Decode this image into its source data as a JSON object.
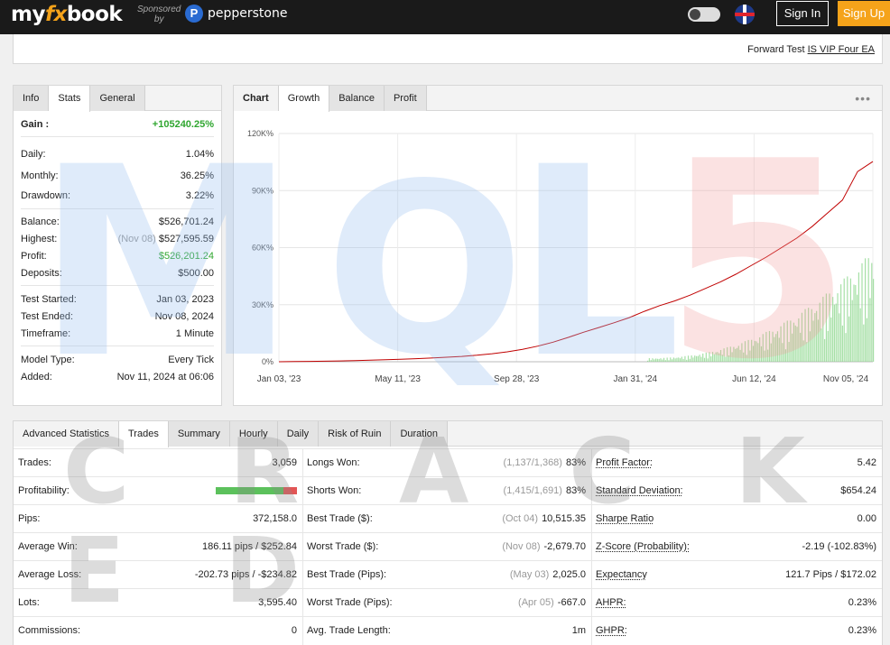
{
  "header": {
    "logo_my": "my",
    "logo_fx": "fx",
    "logo_book": "book",
    "sponsored_line1": "Sponsored",
    "sponsored_line2": "by",
    "sponsor_icon": "P",
    "sponsor_name": "pepperstone",
    "sign_in": "Sign In",
    "sign_up": "Sign Up",
    "accent": "#f5a31a"
  },
  "forward_test": {
    "prefix": "Forward Test",
    "link": "IS VIP Four EA"
  },
  "stats_panel": {
    "tabs": [
      "Info",
      "Stats",
      "General"
    ],
    "active_tab": "Stats",
    "gain_label": "Gain :",
    "gain_value": "+105240.25%",
    "daily_label": "Daily:",
    "daily_value": "1.04%",
    "monthly_label": "Monthly:",
    "monthly_value": "36.25%",
    "drawdown_label": "Drawdown:",
    "drawdown_value": "3.22%",
    "balance_label": "Balance:",
    "balance_value": "$526,701.24",
    "highest_label": "Highest:",
    "highest_date": "(Nov 08)",
    "highest_value": "$527,595.59",
    "profit_label": "Profit:",
    "profit_value": "$526,201.24",
    "deposits_label": "Deposits:",
    "deposits_value": "$500.00",
    "test_started_label": "Test Started:",
    "test_started_value": "Jan 03, 2023",
    "test_ended_label": "Test Ended:",
    "test_ended_value": "Nov 08, 2024",
    "timeframe_label": "Timeframe:",
    "timeframe_value": "1 Minute",
    "model_type_label": "Model Type:",
    "model_type_value": "Every Tick",
    "added_label": "Added:",
    "added_value": "Nov 11, 2024 at 06:06",
    "green": "#2fa62f"
  },
  "chart_panel": {
    "tabs": [
      "Chart",
      "Growth",
      "Balance",
      "Profit"
    ],
    "active_tab": "Growth",
    "menu_icon": "•••"
  },
  "chart_data": {
    "type": "line",
    "yticks": [
      "120K%",
      "90K%",
      "60K%",
      "30K%",
      "0%"
    ],
    "ytick_values": [
      120000,
      90000,
      60000,
      30000,
      0
    ],
    "xticks": [
      "Jan 03, '23",
      "May 11, '23",
      "Sep 28, '23",
      "Jan 31, '24",
      "Jun 12, '24",
      "Nov 05, '24"
    ],
    "ylim": [
      0,
      120000
    ],
    "grid": true,
    "line_color": "#c00000",
    "bar_color": "#90d890",
    "series": [
      {
        "values": [
          0,
          80,
          180,
          300,
          450,
          620,
          820,
          1050,
          1300,
          1600,
          1950,
          2350,
          2800,
          3400,
          4200,
          5200,
          6500,
          8200,
          10300,
          12800,
          15500,
          18000,
          20500,
          23200,
          26500,
          29500,
          32000,
          35000,
          38500,
          42000,
          46000,
          50500,
          55000,
          60000,
          65000,
          71000,
          78000,
          85000,
          100000,
          105240
        ]
      }
    ]
  },
  "advanced": {
    "tabs": [
      "Advanced Statistics",
      "Trades",
      "Summary",
      "Hourly",
      "Daily",
      "Risk of Ruin",
      "Duration"
    ],
    "active_tab": "Trades",
    "col1": [
      {
        "label": "Trades:",
        "value": "3,059"
      },
      {
        "label": "Profitability:",
        "value": ""
      },
      {
        "label": "Pips:",
        "value": "372,158.0"
      },
      {
        "label": "Average Win:",
        "value": "186.11 pips / $252.84"
      },
      {
        "label": "Average Loss:",
        "value": "-202.73 pips / -$234.82"
      },
      {
        "label": "Lots:",
        "value": "3,595.40"
      },
      {
        "label": "Commissions:",
        "value": "0"
      }
    ],
    "profitability_pct": 83,
    "col2": [
      {
        "label": "Longs Won:",
        "dim": "(1,137/1,368)",
        "value": "83%"
      },
      {
        "label": "Shorts Won:",
        "dim": "(1,415/1,691)",
        "value": "83%"
      },
      {
        "label": "Best Trade ($):",
        "dim": "(Oct 04)",
        "value": "10,515.35"
      },
      {
        "label": "Worst Trade ($):",
        "dim": "(Nov 08)",
        "value": "-2,679.70"
      },
      {
        "label": "Best Trade (Pips):",
        "dim": "(May 03)",
        "value": "2,025.0"
      },
      {
        "label": "Worst Trade (Pips):",
        "dim": "(Apr 05)",
        "value": "-667.0"
      },
      {
        "label": "Avg. Trade Length:",
        "dim": "",
        "value": "1m"
      }
    ],
    "col3": [
      {
        "label": "Profit Factor:",
        "value": "5.42"
      },
      {
        "label": "Standard Deviation:",
        "value": "$654.24"
      },
      {
        "label": "Sharpe Ratio",
        "value": "0.00"
      },
      {
        "label": "Z-Score (Probability):",
        "value": "-2.19 (-102.83%)"
      },
      {
        "label": "Expectancy",
        "value": "121.7 Pips / $172.02"
      },
      {
        "label": "AHPR:",
        "value": "0.23%"
      },
      {
        "label": "GHPR:",
        "value": "0.23%"
      }
    ]
  },
  "watermark": {
    "m": "M",
    "q": "Q",
    "l": "L",
    "five": "5",
    "cracked": "C R A C K E D"
  }
}
